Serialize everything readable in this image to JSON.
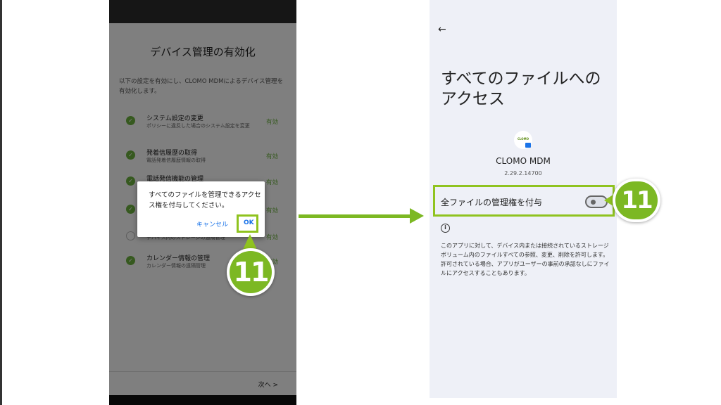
{
  "left_screen": {
    "title": "デバイス管理の有効化",
    "description": "以下の設定を有効にし、CLOMO MDMによるデバイス管理を有効化します。",
    "permissions": [
      {
        "title": "システム設定の変更",
        "sub": "ポリシーに違反した場合のシステム設定を変更",
        "status": "有効"
      },
      {
        "title": "発着信履歴の取得",
        "sub": "電話発着信履歴情報の取得",
        "status": "有効"
      },
      {
        "title": "電話発信機能の管理",
        "sub": "",
        "status": "有効"
      },
      {
        "title": "",
        "sub": "",
        "status": "有効"
      },
      {
        "title": "",
        "sub": "デバイス内のストレージの遠隔管理",
        "status": "有効"
      },
      {
        "title": "カレンダー情報の管理",
        "sub": "カレンダー情報の遠隔管理",
        "status": "有効"
      }
    ],
    "next_label": "次へ >",
    "dialog": {
      "message": "すべてのファイルを管理できるアクセス権を付与してください。",
      "cancel_label": "キャンセル",
      "ok_label": "OK"
    }
  },
  "badges": {
    "step_one": "11",
    "step_two": "11"
  },
  "right_screen": {
    "title": "すべてのファイルへのアクセス",
    "app_name": "CLOMO MDM",
    "app_version": "2.29.2.14700",
    "app_icon_text": "CLOMO",
    "toggle_label": "全ファイルの管理権を付与",
    "toggle_on": false,
    "description": "このアプリに対して、デバイス内または接続されているストレージ ボリューム内のファイルすべての参照、変更、削除を許可します。許可されている場合、アプリがユーザーの事前の承認なしにファイルにアクセスすることもあります。"
  },
  "icons": {
    "back": "back-arrow-icon",
    "info": "info-icon",
    "check": "check-icon"
  },
  "colors": {
    "accent_green": "#7cb823",
    "highlight_green": "#8fc31f",
    "link_blue": "#1a73e8"
  }
}
